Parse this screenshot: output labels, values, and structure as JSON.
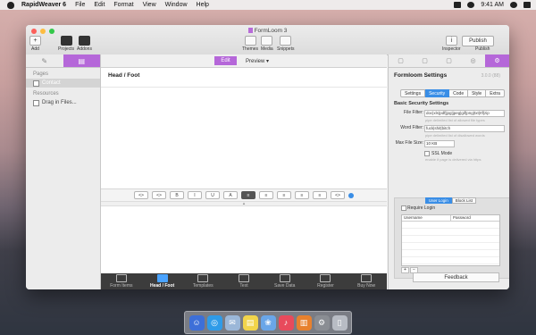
{
  "menubar": {
    "app_name": "RapidWeaver 6",
    "items": [
      "File",
      "Edit",
      "Format",
      "View",
      "Window",
      "Help"
    ],
    "clock": "9:41 AM"
  },
  "window": {
    "title": "FormLoom 3",
    "toolbar": {
      "add": "Add",
      "projects": "Projects",
      "addons": "Addons",
      "themes": "Themes",
      "media": "Media",
      "snippets": "Snippets",
      "inspector": "Inspector",
      "publish_button": "Publish",
      "publish_label": "Publish"
    }
  },
  "sidebar": {
    "pages_header": "Pages",
    "pages": [
      {
        "label": "Contact"
      }
    ],
    "resources_header": "Resources",
    "resources": [
      {
        "label": "Drag in Files..."
      }
    ]
  },
  "editor": {
    "tab_edit": "Edit",
    "tab_preview": "Preview ▾",
    "label": "Head / Foot",
    "format_buttons": [
      "<>",
      "<>",
      "B",
      "I",
      "U",
      "A",
      "≡",
      "≡",
      "≡",
      "≡",
      "≡",
      "<>"
    ],
    "divider_glyph": "▴"
  },
  "bottom_bar": {
    "items": [
      {
        "label": "Form Items",
        "active": false
      },
      {
        "label": "Head / Foot",
        "active": true
      },
      {
        "label": "Templates",
        "active": false
      },
      {
        "label": "Text",
        "active": false
      },
      {
        "label": "Save Data",
        "active": false
      },
      {
        "label": "Register",
        "active": false
      },
      {
        "label": "Buy Now",
        "active": false
      }
    ]
  },
  "inspector": {
    "title": "Formloom Settings",
    "version": "3.0.0 (88)",
    "tabs": [
      "Settings",
      "Security",
      "Code",
      "Style",
      "Extra"
    ],
    "active_tab": "Security",
    "section_title": "Basic Security Settings",
    "file_filter_label": "File Filter:",
    "file_filter_value": "doc|xls|pdf|jpg|jpeg|gif|png|txt|rtf|zip",
    "file_filter_help": "pipe delimited list of allowed file types",
    "word_filter_label": "Word Filter:",
    "word_filter_value": "fuck|shit|bitch",
    "word_filter_help": "pipe delimited list of disallowed words",
    "max_file_size_label": "Max File Size:",
    "max_file_size_value": "10 KB",
    "ssl_label": "SSL Mode",
    "ssl_help": "enable if page is delivered via https",
    "login_tabs": [
      "User Login",
      "Block List"
    ],
    "require_login_label": "Require Login",
    "col_username": "Username",
    "col_password": "Password",
    "plus": "+",
    "minus": "−",
    "feedback": "Feedback"
  },
  "colors": {
    "accent": "#b567d9",
    "blue": "#3a8ee6"
  }
}
